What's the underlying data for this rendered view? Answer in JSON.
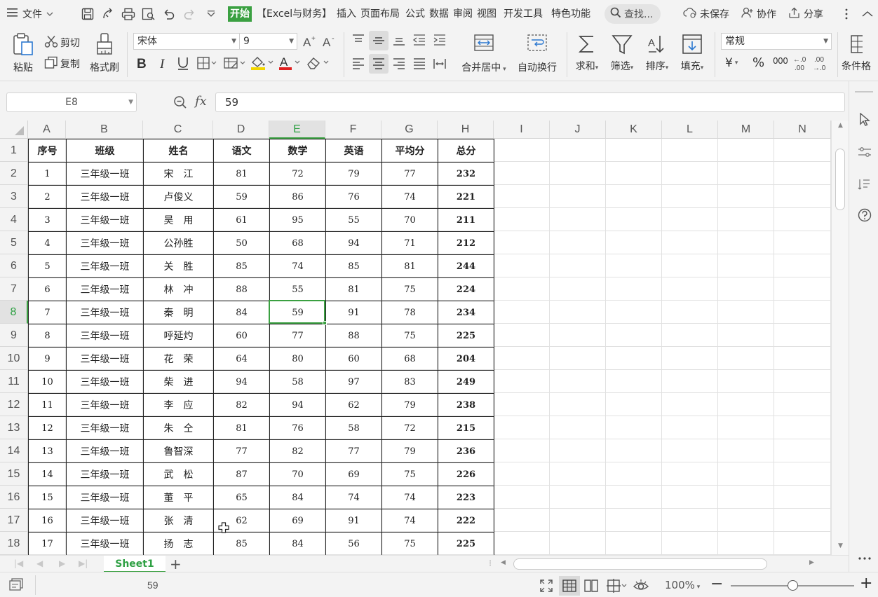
{
  "menubar": {
    "file_label": "文件",
    "tabs": [
      {
        "label": "开始",
        "active": true
      },
      {
        "label": "【Excel与财务】",
        "active": false
      },
      {
        "label": "插入",
        "active": false
      },
      {
        "label": "页面布局",
        "active": false
      },
      {
        "label": "公式",
        "active": false
      },
      {
        "label": "数据",
        "active": false
      },
      {
        "label": "审阅",
        "active": false
      },
      {
        "label": "视图",
        "active": false
      },
      {
        "label": "开发工具",
        "active": false
      },
      {
        "label": "特色功能",
        "active": false
      }
    ],
    "search_label": "查找...",
    "unsaved_label": "未保存",
    "collab_label": "协作",
    "share_label": "分享"
  },
  "ribbon": {
    "paste": "粘贴",
    "cut": "剪切",
    "copy": "复制",
    "format_painter": "格式刷",
    "font_name": "宋体",
    "font_size": "9",
    "merge_center": "合并居中",
    "wrap_text": "自动换行",
    "number_format": "常规",
    "currency_symbol": "¥",
    "percent_symbol": "%",
    "thousands_symbol": "000",
    "sum": "求和",
    "filter": "筛选",
    "sort": "排序",
    "fill": "填充",
    "conditional": "条件格"
  },
  "formula_bar": {
    "name_box": "E8",
    "fx_label": "fx",
    "value": "59"
  },
  "grid": {
    "columns": [
      "A",
      "B",
      "C",
      "D",
      "E",
      "F",
      "G",
      "H",
      "I",
      "J",
      "K",
      "L",
      "M",
      "N"
    ],
    "rows": [
      "1",
      "2",
      "3",
      "4",
      "5",
      "6",
      "7",
      "8",
      "9",
      "10",
      "11",
      "12",
      "13",
      "14",
      "15",
      "16",
      "17",
      "18"
    ],
    "selected_column": "E",
    "selected_row": "8"
  },
  "table": {
    "headers": [
      "序号",
      "班级",
      "姓名",
      "语文",
      "数学",
      "英语",
      "平均分",
      "总分"
    ],
    "rows": [
      [
        "1",
        "三年级一班",
        "宋　江",
        "81",
        "72",
        "79",
        "77",
        "232"
      ],
      [
        "2",
        "三年级一班",
        "卢俊义",
        "59",
        "86",
        "76",
        "74",
        "221"
      ],
      [
        "3",
        "三年级一班",
        "吴　用",
        "61",
        "95",
        "55",
        "70",
        "211"
      ],
      [
        "4",
        "三年级一班",
        "公孙胜",
        "50",
        "68",
        "94",
        "71",
        "212"
      ],
      [
        "5",
        "三年级一班",
        "关　胜",
        "85",
        "74",
        "85",
        "81",
        "244"
      ],
      [
        "6",
        "三年级一班",
        "林　冲",
        "88",
        "55",
        "81",
        "75",
        "224"
      ],
      [
        "7",
        "三年级一班",
        "秦　明",
        "84",
        "59",
        "91",
        "78",
        "234"
      ],
      [
        "8",
        "三年级一班",
        "呼延灼",
        "60",
        "77",
        "88",
        "75",
        "225"
      ],
      [
        "9",
        "三年级一班",
        "花　荣",
        "64",
        "80",
        "60",
        "68",
        "204"
      ],
      [
        "10",
        "三年级一班",
        "柴　进",
        "94",
        "58",
        "97",
        "83",
        "249"
      ],
      [
        "11",
        "三年级一班",
        "李　应",
        "82",
        "94",
        "62",
        "79",
        "238"
      ],
      [
        "12",
        "三年级一班",
        "朱　仝",
        "81",
        "76",
        "58",
        "72",
        "215"
      ],
      [
        "13",
        "三年级一班",
        "鲁智深",
        "77",
        "82",
        "77",
        "79",
        "236"
      ],
      [
        "14",
        "三年级一班",
        "武　松",
        "87",
        "70",
        "69",
        "75",
        "226"
      ],
      [
        "15",
        "三年级一班",
        "董　平",
        "65",
        "84",
        "74",
        "74",
        "223"
      ],
      [
        "16",
        "三年级一班",
        "张　清",
        "62",
        "69",
        "91",
        "74",
        "222"
      ],
      [
        "17",
        "三年级一班",
        "扬　志",
        "85",
        "84",
        "56",
        "75",
        "225"
      ]
    ]
  },
  "sheets": {
    "tabs": [
      "Sheet1"
    ],
    "active": "Sheet1",
    "add_label": "+"
  },
  "status": {
    "value": "59",
    "zoom": "100%",
    "zoom_minus": "−",
    "zoom_plus": "+",
    "zoom_level": 0.5
  },
  "colors": {
    "accent": "#3aa041",
    "ribbon_bg": "#f3f3f3",
    "grid_line": "#e1e1e1",
    "table_border": "#222222"
  }
}
